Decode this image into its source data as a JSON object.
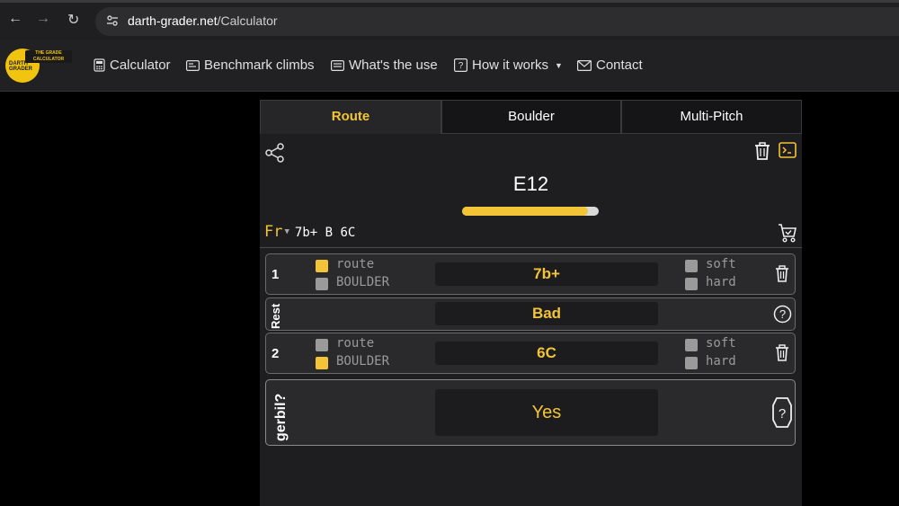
{
  "browser": {
    "url_host": "darth-grader.net",
    "url_path": "/Calculator"
  },
  "site": {
    "logo": {
      "banner_text": "THE GRADE CALCULATOR",
      "badge_text": "DARTH GRADER"
    },
    "nav": [
      {
        "label": "Calculator",
        "icon": "calculator-icon"
      },
      {
        "label": "Benchmark climbs",
        "icon": "card-icon"
      },
      {
        "label": "What's the use",
        "icon": "message-icon"
      },
      {
        "label": "How it works",
        "icon": "question-box-icon",
        "dropdown": true
      },
      {
        "label": "Contact",
        "icon": "envelope-icon"
      }
    ]
  },
  "calculator": {
    "tabs": [
      "Route",
      "Boulder",
      "Multi-Pitch"
    ],
    "active_tab": "Route",
    "result_grade": "E12",
    "progress_fraction": 0.92,
    "scale": {
      "selected": "Fr",
      "summary": "7b+ B 6C"
    },
    "climbs": [
      {
        "number": "1",
        "type_route_label": "route",
        "type_boulder_label": "BOULDER",
        "type": "route",
        "grade": "7b+",
        "soft_label": "soft",
        "hard_label": "hard"
      },
      {
        "number": "2",
        "type_route_label": "route",
        "type_boulder_label": "BOULDER",
        "type": "boulder",
        "grade": "6C",
        "soft_label": "soft",
        "hard_label": "hard"
      }
    ],
    "rest": {
      "label": "Rest",
      "value": "Bad"
    },
    "gerbil": {
      "label": "gerbil?",
      "value": "Yes"
    }
  },
  "colors": {
    "accent": "#f3c437",
    "panel": "#1e1e20",
    "card": "#2a2a2c"
  }
}
